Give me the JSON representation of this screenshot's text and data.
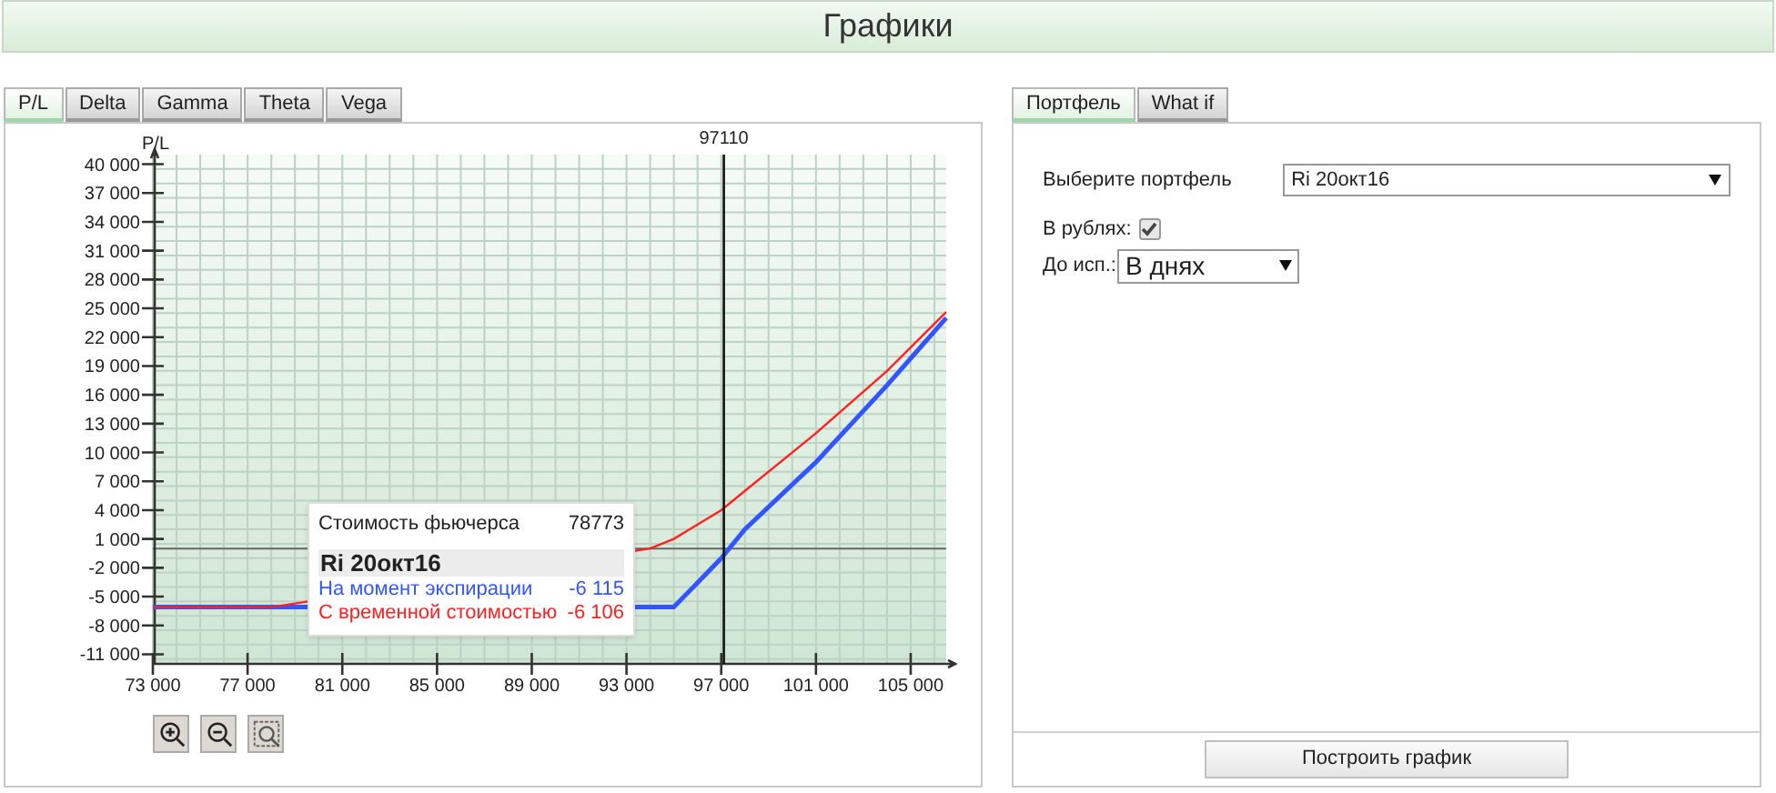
{
  "header": {
    "title": "Графики"
  },
  "chart_tabs": [
    {
      "label": "P/L",
      "selected": true
    },
    {
      "label": "Delta",
      "selected": false
    },
    {
      "label": "Gamma",
      "selected": false
    },
    {
      "label": "Theta",
      "selected": false
    },
    {
      "label": "Vega",
      "selected": false
    }
  ],
  "chart": {
    "chart_data": {
      "type": "line",
      "ylabel": "P/L",
      "x": [
        73000,
        78000,
        94000,
        95000,
        97000,
        98000,
        101000,
        104000,
        106500
      ],
      "series": [
        {
          "name": "На момент экспирации",
          "color": "#3355ff",
          "values": [
            -6100,
            -6100,
            -6100,
            -6100,
            -1000,
            2000,
            9000,
            17000,
            24000
          ]
        },
        {
          "name": "С временной стоимостью",
          "color": "#ff2020",
          "values": [
            -6100,
            -6100,
            0,
            1000,
            4000,
            6000,
            12000,
            18500,
            24600
          ]
        }
      ],
      "grid": true,
      "xlim": [
        73000,
        106500
      ],
      "ylim": [
        -12000,
        41000
      ],
      "xticks": [
        {
          "value": 73000,
          "label": "73 000"
        },
        {
          "value": 77000,
          "label": "77 000"
        },
        {
          "value": 81000,
          "label": "81 000"
        },
        {
          "value": 85000,
          "label": "85 000"
        },
        {
          "value": 89000,
          "label": "89 000"
        },
        {
          "value": 93000,
          "label": "93 000"
        },
        {
          "value": 97000,
          "label": "97 000"
        },
        {
          "value": 101000,
          "label": "101 000"
        },
        {
          "value": 105000,
          "label": "105 000"
        }
      ],
      "yticks": [
        {
          "value": 40000,
          "label": "40 000"
        },
        {
          "value": 37000,
          "label": "37 000"
        },
        {
          "value": 34000,
          "label": "34 000"
        },
        {
          "value": 31000,
          "label": "31 000"
        },
        {
          "value": 28000,
          "label": "28 000"
        },
        {
          "value": 25000,
          "label": "25 000"
        },
        {
          "value": 22000,
          "label": "22 000"
        },
        {
          "value": 19000,
          "label": "19 000"
        },
        {
          "value": 16000,
          "label": "16 000"
        },
        {
          "value": 13000,
          "label": "13 000"
        },
        {
          "value": 10000,
          "label": "10 000"
        },
        {
          "value": 7000,
          "label": "7 000"
        },
        {
          "value": 4000,
          "label": "4 000"
        },
        {
          "value": 1000,
          "label": "1 000"
        },
        {
          "value": -2000,
          "label": "-2 000"
        },
        {
          "value": -5000,
          "label": "-5 000"
        },
        {
          "value": -8000,
          "label": "-8 000"
        },
        {
          "value": -11000,
          "label": "-11 000"
        }
      ],
      "ref_lines": [
        {
          "axis": "x",
          "value": 97110,
          "label": "97110"
        }
      ]
    },
    "tooltip": {
      "title": "Стоимость фьючерса",
      "value": "78773",
      "heading": "Ri 20окт16",
      "readings": [
        "-6 115",
        "-6 106"
      ]
    }
  },
  "zoom_buttons": [
    {
      "kind": "zoom-in"
    },
    {
      "kind": "zoom-out"
    },
    {
      "kind": "zoom-area"
    }
  ],
  "settings_tabs": [
    {
      "label": "Портфель",
      "selected": true
    },
    {
      "label": "What if",
      "selected": false
    }
  ],
  "portfolio": {
    "label": "Выберите портфель",
    "value": "Ri 20окт16"
  },
  "rubles": {
    "label": "В рублях:",
    "checked": true
  },
  "expiry": {
    "label": "До исп.:",
    "value": "В днях"
  },
  "build_button": {
    "label": "Построить график"
  }
}
